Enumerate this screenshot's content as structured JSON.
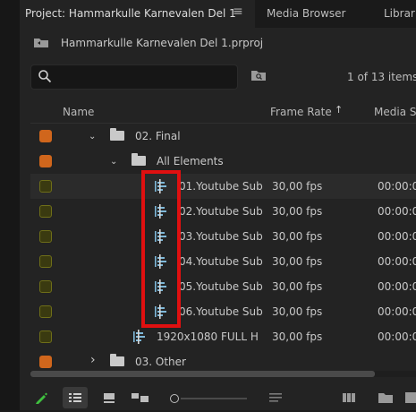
{
  "tabs": {
    "project_title": "Project: Hammarkulle Karnevalen Del 1",
    "menu_glyph": "≡",
    "media_browser": "Media Browser",
    "libraries": "Librari"
  },
  "path": {
    "text": "Hammarkulle Karnevalen Del 1.prproj"
  },
  "search": {
    "value": "",
    "placeholder": "",
    "count": "1 of 13 items s"
  },
  "columns": {
    "name": "Name",
    "frame_rate": "Frame Rate",
    "sort_arrow": "↑",
    "media_start": "Media St"
  },
  "rows": [
    {
      "kind": "folder",
      "expand": "⌄",
      "name": "02. Final",
      "frame_rate": "",
      "media_start": "",
      "color": "#d0661c"
    },
    {
      "kind": "folder",
      "expand": "⌄",
      "name": "All Elements",
      "frame_rate": "",
      "media_start": "",
      "color": "#d0661c"
    },
    {
      "kind": "sequence",
      "name": "01.Youtube Sub",
      "frame_rate": "30,00 fps",
      "media_start": "00:00:00",
      "color": "#6e6e18"
    },
    {
      "kind": "sequence",
      "name": "02.Youtube Sub",
      "frame_rate": "30,00 fps",
      "media_start": "00:00:00",
      "color": "#6e6e18"
    },
    {
      "kind": "sequence",
      "name": "03.Youtube Sub",
      "frame_rate": "30,00 fps",
      "media_start": "00:00:00",
      "color": "#6e6e18"
    },
    {
      "kind": "sequence",
      "name": "04.Youtube Sub",
      "frame_rate": "30,00 fps",
      "media_start": "00:00:00",
      "color": "#6e6e18"
    },
    {
      "kind": "sequence",
      "name": "05.Youtube Sub",
      "frame_rate": "30,00 fps",
      "media_start": "00:00:00",
      "color": "#6e6e18"
    },
    {
      "kind": "sequence",
      "name": "06.Youtube Sub",
      "frame_rate": "30,00 fps",
      "media_start": "00:00:00",
      "color": "#6e6e18"
    },
    {
      "kind": "sequence",
      "name": "1920x1080 FULL H",
      "frame_rate": "30,00 fps",
      "media_start": "00:00:00",
      "color": "#6e6e18"
    },
    {
      "kind": "folder",
      "expand": "›",
      "name": "03. Other",
      "frame_rate": "",
      "media_start": "",
      "color": "#d0661c"
    }
  ],
  "colors": {
    "accent_highlight": "#e01010",
    "sequence_icon": "#7fb8d8",
    "pen": "#3fbf3f"
  }
}
